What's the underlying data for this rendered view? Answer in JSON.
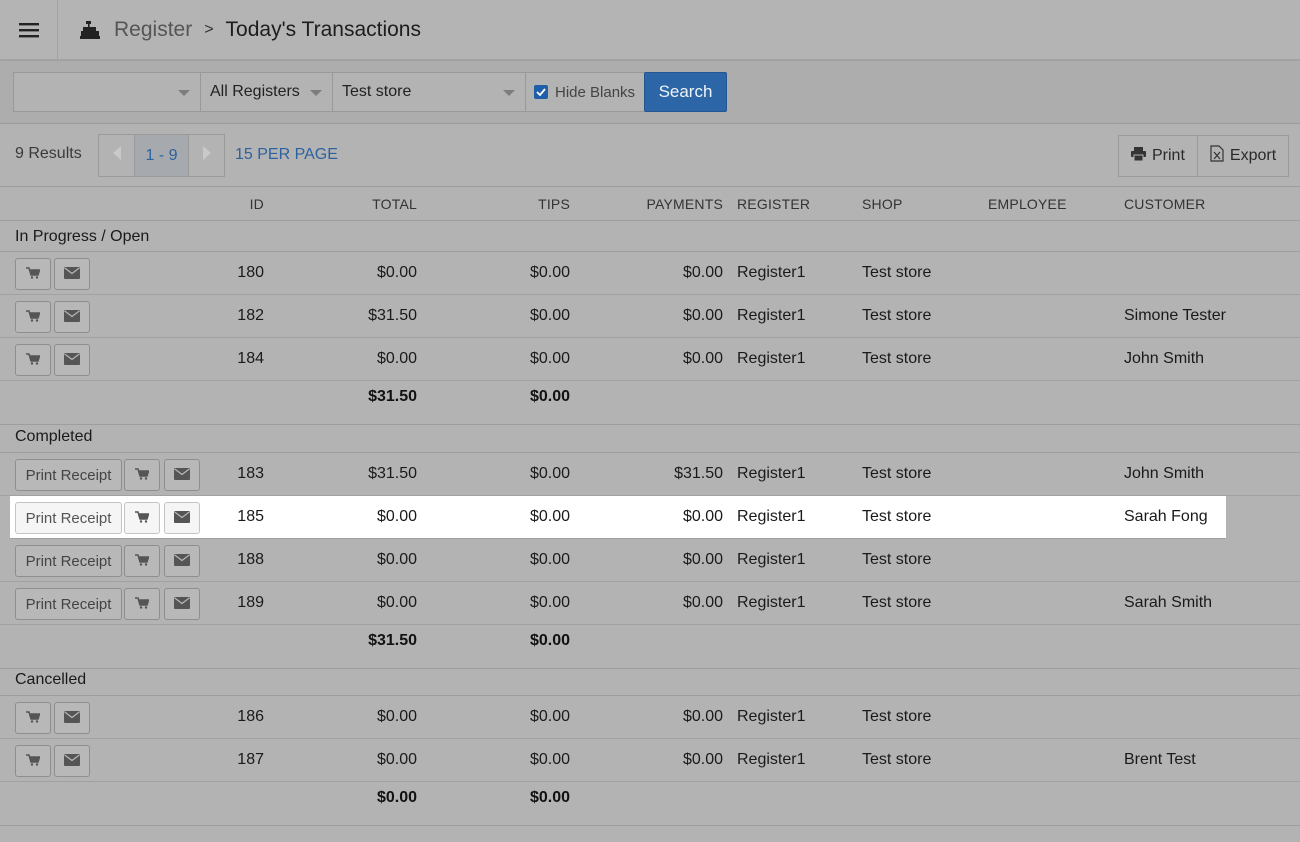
{
  "header": {
    "breadcrumb_parent": "Register",
    "breadcrumb_current": "Today's Transactions",
    "separator": ">"
  },
  "filters": {
    "first_select_value": "",
    "register_select_value": "All Registers",
    "shop_select_value": "Test store",
    "hide_blanks_label": "Hide Blanks",
    "hide_blanks_checked": true,
    "search_label": "Search"
  },
  "results": {
    "count_label": "9 Results",
    "page_range": "1 - 9",
    "per_page_label": "15 PER PAGE",
    "print_label": "Print",
    "export_label": "Export"
  },
  "columns": [
    "ID",
    "TOTAL",
    "TIPS",
    "PAYMENTS",
    "REGISTER",
    "SHOP",
    "EMPLOYEE",
    "CUSTOMER"
  ],
  "action_labels": {
    "print_receipt": "Print Receipt"
  },
  "sections": [
    {
      "label": "In Progress / Open",
      "rows": [
        {
          "id": "180",
          "total": "$0.00",
          "tips": "$0.00",
          "payments": "$0.00",
          "register": "Register1",
          "shop": "Test store",
          "employee": "",
          "customer": ""
        },
        {
          "id": "182",
          "total": "$31.50",
          "tips": "$0.00",
          "payments": "$0.00",
          "register": "Register1",
          "shop": "Test store",
          "employee": "",
          "customer": "Simone Tester"
        },
        {
          "id": "184",
          "total": "$0.00",
          "tips": "$0.00",
          "payments": "$0.00",
          "register": "Register1",
          "shop": "Test store",
          "employee": "",
          "customer": "John Smith"
        }
      ],
      "total_sum": "$31.50",
      "tips_sum": "$0.00"
    },
    {
      "label": "Completed",
      "rows": [
        {
          "id": "183",
          "total": "$31.50",
          "tips": "$0.00",
          "payments": "$31.50",
          "register": "Register1",
          "shop": "Test store",
          "employee": "",
          "customer": "John Smith"
        },
        {
          "id": "185",
          "total": "$0.00",
          "tips": "$0.00",
          "payments": "$0.00",
          "register": "Register1",
          "shop": "Test store",
          "employee": "",
          "customer": "Sarah Fong"
        },
        {
          "id": "188",
          "total": "$0.00",
          "tips": "$0.00",
          "payments": "$0.00",
          "register": "Register1",
          "shop": "Test store",
          "employee": "",
          "customer": ""
        },
        {
          "id": "189",
          "total": "$0.00",
          "tips": "$0.00",
          "payments": "$0.00",
          "register": "Register1",
          "shop": "Test store",
          "employee": "",
          "customer": "Sarah Smith"
        }
      ],
      "total_sum": "$31.50",
      "tips_sum": "$0.00"
    },
    {
      "label": "Cancelled",
      "rows": [
        {
          "id": "186",
          "total": "$0.00",
          "tips": "$0.00",
          "payments": "$0.00",
          "register": "Register1",
          "shop": "Test store",
          "employee": "",
          "customer": ""
        },
        {
          "id": "187",
          "total": "$0.00",
          "tips": "$0.00",
          "payments": "$0.00",
          "register": "Register1",
          "shop": "Test store",
          "employee": "",
          "customer": "Brent Test"
        }
      ],
      "total_sum": "$0.00",
      "tips_sum": "$0.00"
    }
  ],
  "icons": {
    "menu": "hamburger-icon",
    "register": "cash-register-icon",
    "print": "printer-icon",
    "export": "excel-file-icon",
    "cart": "cart-icon",
    "email": "envelope-icon"
  },
  "colors": {
    "accent": "#2c66a6",
    "link": "#2d62a0",
    "background": "#b3b3b3",
    "highlight_row": "#ffffff"
  }
}
